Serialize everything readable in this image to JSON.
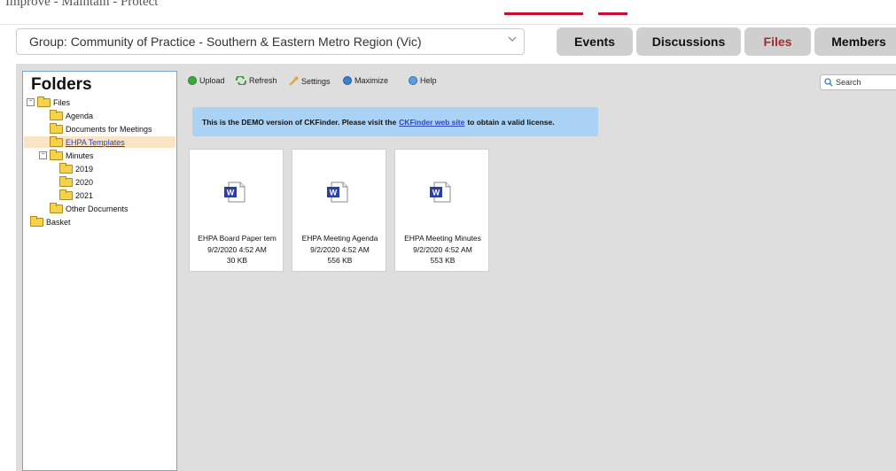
{
  "header": {
    "tagline": "Improve - Maintain - Protect",
    "group_select_value": "Group: Community of Practice - Southern & Eastern Metro Region (Vic)"
  },
  "nav": {
    "events": "Events",
    "discussions": "Discussions",
    "files": "Files",
    "members": "Members",
    "active_color": "#a52a2a"
  },
  "ckfinder": {
    "folders_title": "Folders",
    "tree": [
      {
        "label": "Files",
        "toggle": "−"
      },
      {
        "label": "Agenda"
      },
      {
        "label": "Documents for Meetings"
      },
      {
        "label": "EHPA Templates",
        "selected": true
      },
      {
        "label": "Minutes",
        "toggle": "−"
      },
      {
        "label": "2019"
      },
      {
        "label": "2020"
      },
      {
        "label": "2021"
      },
      {
        "label": "Other Documents"
      },
      {
        "label": "Basket"
      }
    ],
    "toolbar": {
      "upload": "Upload",
      "refresh": "Refresh",
      "settings": "Settings",
      "maximize": "Maximize",
      "help": "Help",
      "search_placeholder": "Search"
    },
    "demo_notice": {
      "before": "This is the DEMO version of CKFinder. Please visit the",
      "link": "CKFinder web site",
      "after": "to obtain a valid license."
    },
    "files": [
      {
        "name": "EHPA Board Paper tem",
        "date": "9/2/2020 4:52 AM",
        "size": "30 KB",
        "icon": "word-document-icon"
      },
      {
        "name": "EHPA Meeting Agenda",
        "date": "9/2/2020 4:52 AM",
        "size": "556 KB",
        "icon": "word-document-icon"
      },
      {
        "name": "EHPA Meeting Minutes",
        "date": "9/2/2020 4:52 AM",
        "size": "553 KB",
        "icon": "word-document-icon"
      }
    ]
  }
}
